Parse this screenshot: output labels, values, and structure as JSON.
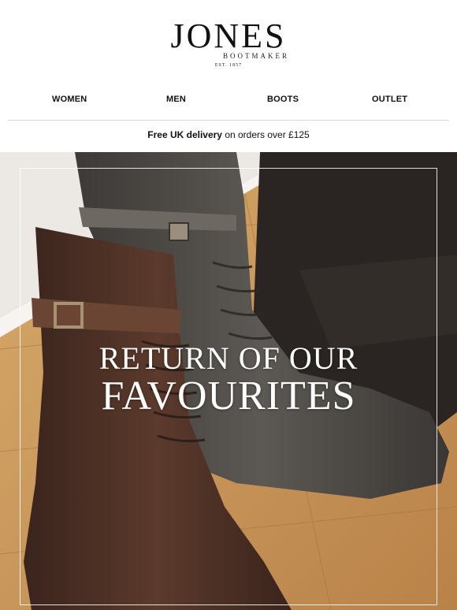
{
  "logo": {
    "word": "JONES",
    "sub": "BOOTMAKER",
    "est": "EST. 1857"
  },
  "nav": {
    "items": [
      {
        "label": "WOMEN"
      },
      {
        "label": "MEN"
      },
      {
        "label": "BOOTS"
      },
      {
        "label": "OUTLET"
      }
    ]
  },
  "delivery": {
    "bold": "Free UK delivery",
    "rest": " on orders over £125"
  },
  "hero": {
    "line1": "RETURN OF OUR",
    "line2": "FAVOURITES"
  },
  "colors": {
    "floor": "#c8965a",
    "wall": "#ece8e4",
    "brown_boot": "#4a3026",
    "grey_boot": "#4f4b47",
    "black_boot": "#2a2522"
  }
}
